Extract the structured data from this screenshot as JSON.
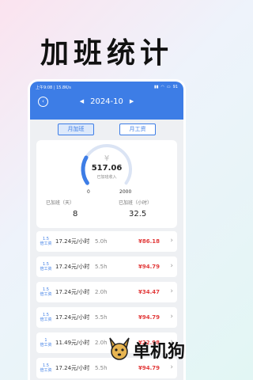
{
  "promo": {
    "title": "加班统计"
  },
  "status_bar": {
    "time": "上午9:08",
    "net": "15.8K/s",
    "battery": "91"
  },
  "header": {
    "month": "2024-10",
    "prev": "◀",
    "next": "▶"
  },
  "tabs": [
    {
      "label": "月加班",
      "active": true
    },
    {
      "label": "月工资",
      "active": false
    }
  ],
  "summary": {
    "currency_icon": "¥",
    "income_value": "517.06",
    "income_caption": "已加班收入",
    "gauge_min": "0",
    "gauge_max": "2000",
    "gauge_fraction": 0.26,
    "days_label": "已加班（天）",
    "days_value": "8",
    "hours_label": "已加班（小时）",
    "hours_value": "32.5"
  },
  "records": [
    {
      "mult": "1.5",
      "mult_label": "倍工资",
      "rate": "17.24元/小时",
      "hours": "5.0h",
      "amount": "¥86.18"
    },
    {
      "mult": "1.5",
      "mult_label": "倍工资",
      "rate": "17.24元/小时",
      "hours": "5.5h",
      "amount": "¥94.79"
    },
    {
      "mult": "1.5",
      "mult_label": "倍工资",
      "rate": "17.24元/小时",
      "hours": "2.0h",
      "amount": "¥34.47"
    },
    {
      "mult": "1.5",
      "mult_label": "倍工资",
      "rate": "17.24元/小时",
      "hours": "5.5h",
      "amount": "¥94.79"
    },
    {
      "mult": "1",
      "mult_label": "倍工资",
      "rate": "11.49元/小时",
      "hours": "2.0h",
      "amount": "¥22.98"
    },
    {
      "mult": "1.5",
      "mult_label": "倍工资",
      "rate": "17.24元/小时",
      "hours": "5.5h",
      "amount": "¥94.79"
    }
  ],
  "watermark": {
    "text": "单机狗"
  },
  "colors": {
    "accent": "#3d7de6",
    "money": "#e23a3a"
  }
}
